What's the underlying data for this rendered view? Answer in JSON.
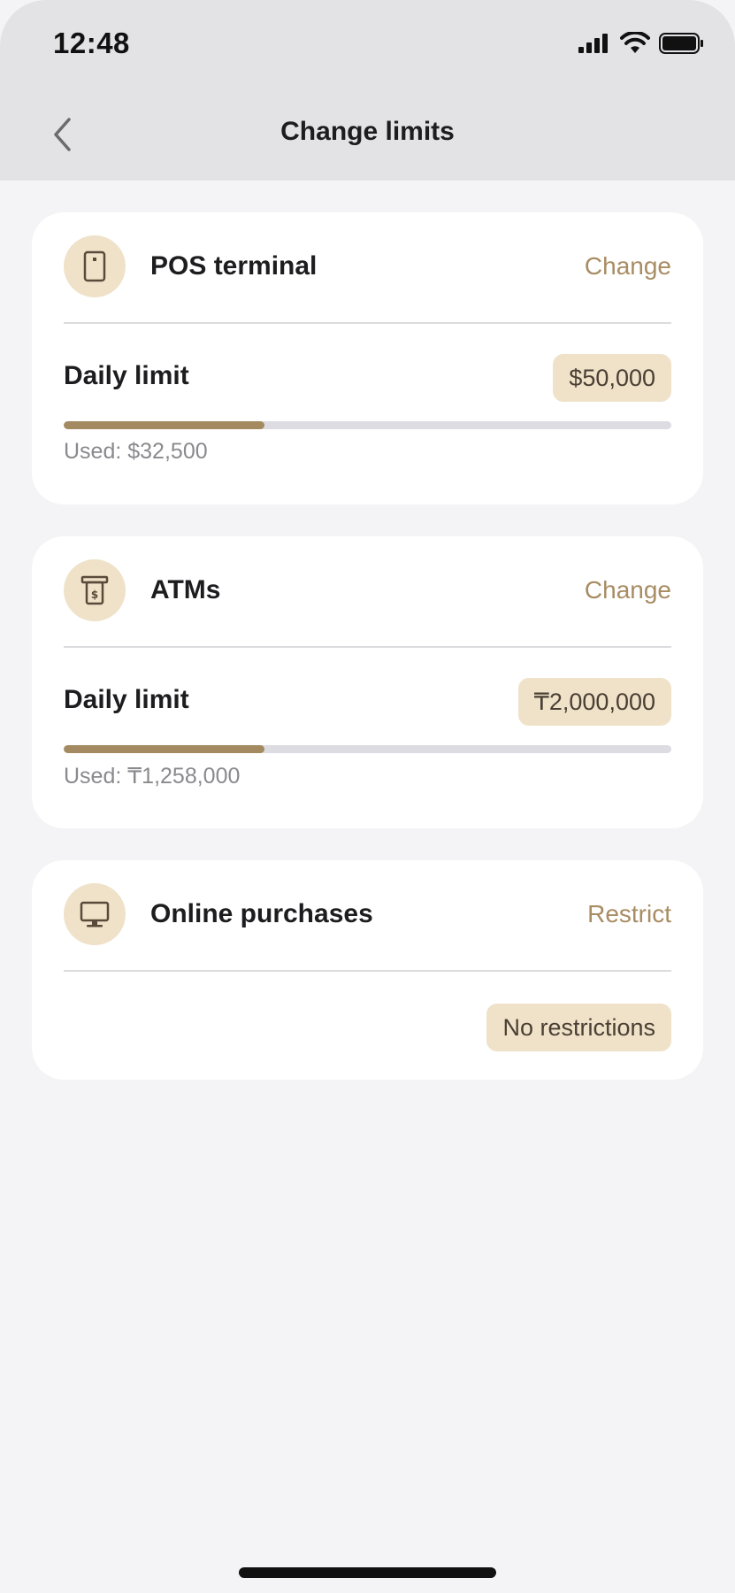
{
  "status_bar": {
    "time": "12:48",
    "icons": [
      "signal-icon",
      "wifi-icon",
      "battery-icon"
    ]
  },
  "nav": {
    "back_icon": "chevron-left-icon",
    "title": "Change limits"
  },
  "colors": {
    "accent": "#a88c63",
    "pill_bg": "#efe2c9",
    "progress_fill": "#a48a61",
    "progress_track": "#dcdce2",
    "header_bg": "#e3e3e6",
    "page_bg": "#f4f4f6"
  },
  "cards": [
    {
      "icon": "pos-terminal-icon",
      "title": "POS terminal",
      "action": "Change",
      "limit_label": "Daily limit",
      "limit_value": "$50,000",
      "used_text": "Used: $32,500",
      "used_fraction": 0.33
    },
    {
      "icon": "atm-icon",
      "title": "ATMs",
      "action": "Change",
      "limit_label": "Daily limit",
      "limit_value": "₸2,000,000",
      "used_text": "Used: ₸1,258,000",
      "used_fraction": 0.33
    },
    {
      "icon": "monitor-icon",
      "title": "Online purchases",
      "action": "Restrict",
      "status_value": "No restrictions"
    }
  ]
}
